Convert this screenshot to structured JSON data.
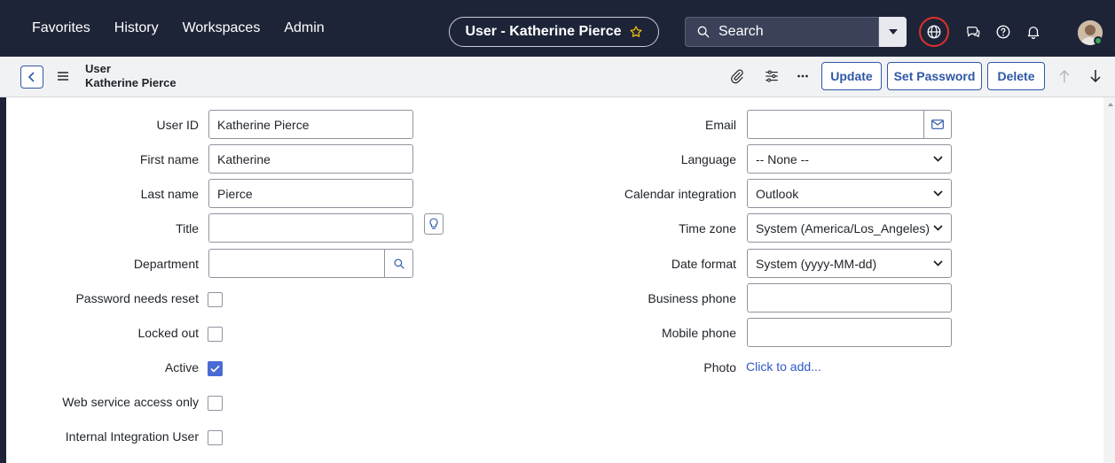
{
  "nav": {
    "links": [
      "Favorites",
      "History",
      "Workspaces",
      "Admin"
    ],
    "record_title": "User - Katherine Pierce",
    "search_label": "Search"
  },
  "toolbar": {
    "record_type": "User",
    "record_name": "Katherine Pierce",
    "update_label": "Update",
    "set_password_label": "Set Password",
    "delete_label": "Delete"
  },
  "form": {
    "left": [
      {
        "label": "User ID",
        "value": "Katherine Pierce"
      },
      {
        "label": "First name",
        "value": "Katherine"
      },
      {
        "label": "Last name",
        "value": "Pierce"
      },
      {
        "label": "Title",
        "value": ""
      },
      {
        "label": "Department",
        "value": ""
      }
    ],
    "checkboxes": [
      {
        "label": "Password needs reset",
        "checked": false
      },
      {
        "label": "Locked out",
        "checked": false
      },
      {
        "label": "Active",
        "checked": true
      },
      {
        "label": "Web service access only",
        "checked": false
      },
      {
        "label": "Internal Integration User",
        "checked": false
      }
    ],
    "right": [
      {
        "label": "Email",
        "value": ""
      },
      {
        "label": "Language",
        "value": "-- None --"
      },
      {
        "label": "Calendar integration",
        "value": "Outlook"
      },
      {
        "label": "Time zone",
        "value": "System (America/Los_Angeles)"
      },
      {
        "label": "Date format",
        "value": "System (yyyy-MM-dd)"
      },
      {
        "label": "Business phone",
        "value": ""
      },
      {
        "label": "Mobile phone",
        "value": ""
      }
    ],
    "photo_label": "Photo",
    "photo_action": "Click to add..."
  },
  "colors": {
    "nav_bg": "#1e2438",
    "accent": "#2f57a7",
    "checkbox_checked": "#4a6bd6",
    "focus_ring": "#e0302b"
  }
}
